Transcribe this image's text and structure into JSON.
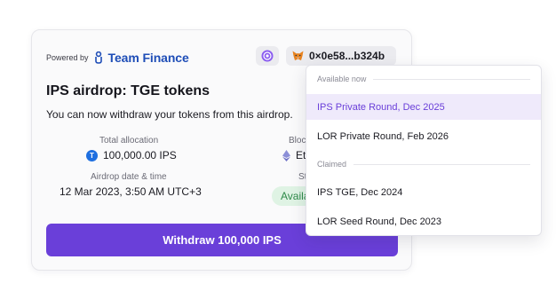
{
  "card": {
    "powered_by": "Powered by",
    "brand": "Team Finance",
    "wallet_address": "0×0e58...b324b",
    "title": "IPS airdrop:  TGE tokens",
    "subtitle": "You can now withdraw your tokens from this airdrop.",
    "stats": {
      "total_allocation_label": "Total allocation",
      "total_allocation_value": "100,000.00 IPS",
      "blockchain_label": "Bloc",
      "blockchain_value": "Et",
      "airdrop_date_label": "Airdrop date & time",
      "airdrop_date_value": "12 Mar 2023, 3:50 AM UTC+3",
      "status_label": "St",
      "status_value": "Availa"
    },
    "withdraw_button": "Withdraw 100,000 IPS"
  },
  "dropdown": {
    "available_header": "Available now",
    "available_items": [
      "IPS Private Round, Dec 2025",
      "LOR Private Round, Feb 2026"
    ],
    "claimed_header": "Claimed",
    "claimed_items": [
      "IPS TGE, Dec 2024",
      "LOR Seed Round, Dec 2023"
    ]
  },
  "colors": {
    "accent": "#6a3fd9",
    "brand_blue": "#1e4db7",
    "status_green": "#2e8a49",
    "status_green_bg": "#dff3e4",
    "selected_bg": "#efeafb"
  },
  "icons": {
    "brand_logo": "team-finance-logo",
    "network": "network-icon",
    "wallet": "metamask-fox-icon",
    "token": "usdt-token-icon",
    "chain": "ethereum-icon"
  }
}
